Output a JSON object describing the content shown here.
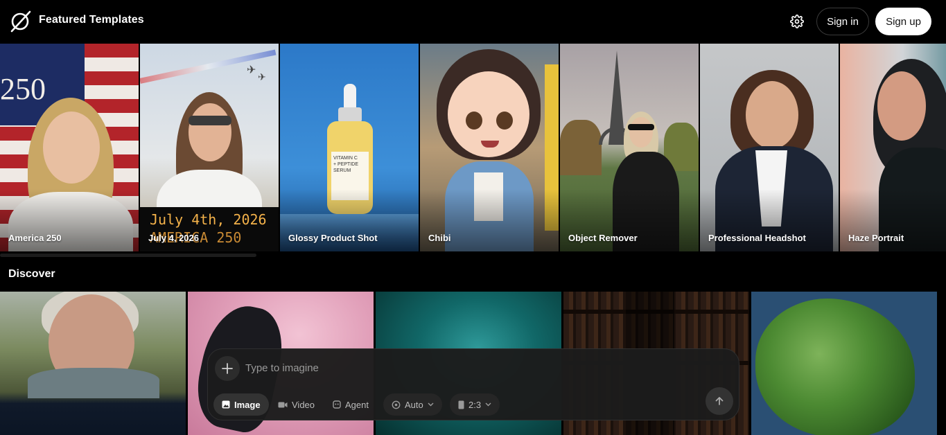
{
  "header": {
    "title": "Featured Templates",
    "logo_icon": "slashed-circle-logo-icon",
    "settings_icon": "gear-icon",
    "sign_in_label": "Sign in",
    "sign_up_label": "Sign up"
  },
  "templates": [
    {
      "label": "America 250"
    },
    {
      "label": "July 4, 2026"
    },
    {
      "label": "Glossy Product Shot"
    },
    {
      "label": "Chibi"
    },
    {
      "label": "Object Remover"
    },
    {
      "label": "Professional Headshot"
    },
    {
      "label": "Haze Portrait"
    }
  ],
  "template_art": {
    "flag_text": "250",
    "banner_line1": "July 4th, 2026",
    "banner_line2": "AMERICA 250",
    "bottle_text_1": "VITAMIN C",
    "bottle_text_2": "+ PEPTIDE",
    "bottle_text_3": "SERUM"
  },
  "discover": {
    "title": "Discover"
  },
  "prompt": {
    "placeholder": "Type to imagine",
    "add_icon": "plus-icon",
    "send_icon": "arrow-up-icon",
    "modes": [
      {
        "label": "Image",
        "icon": "image-icon",
        "active": true
      },
      {
        "label": "Video",
        "icon": "video-camera-icon",
        "active": false
      },
      {
        "label": "Agent",
        "icon": "agent-icon",
        "active": false
      }
    ],
    "model_label": "Auto",
    "aspect_label": "2:3"
  },
  "colors": {
    "background": "#000000",
    "panel": "#1c1c1c",
    "chip_active": "#333333",
    "sign_up_bg": "#ffffff"
  }
}
